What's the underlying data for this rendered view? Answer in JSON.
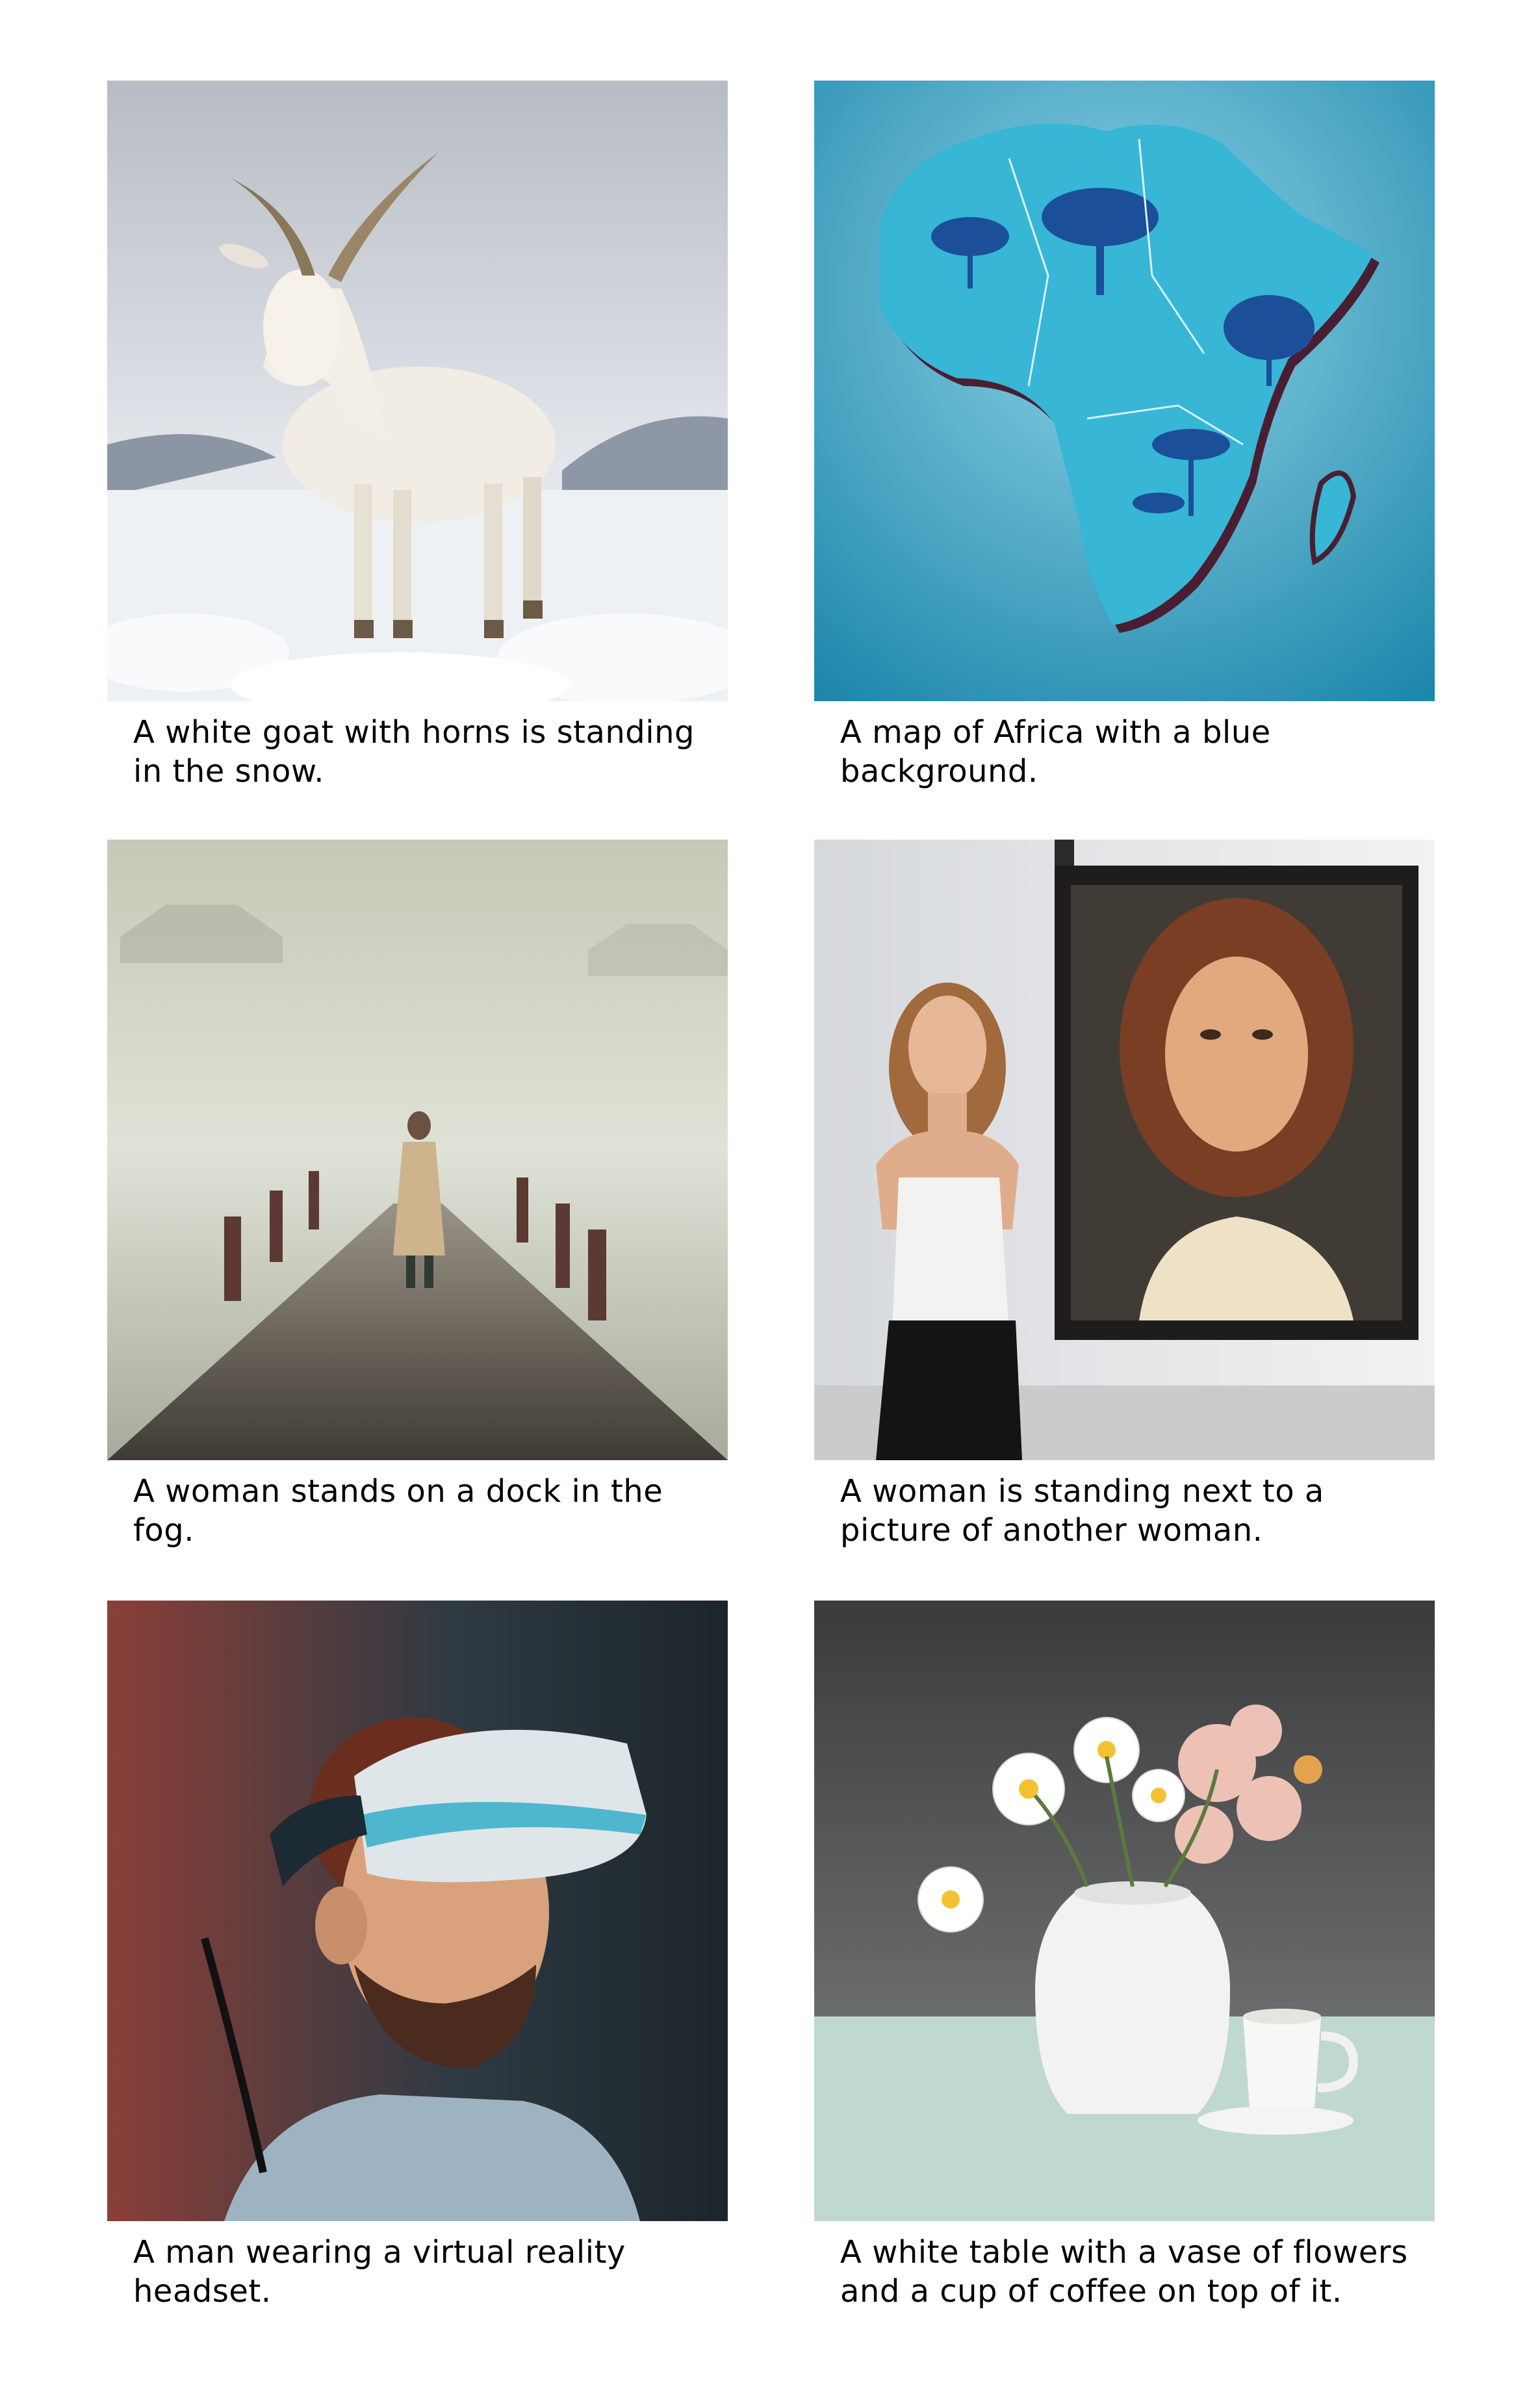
{
  "items": [
    {
      "caption": "A white goat with horns is standing in the snow."
    },
    {
      "caption": "A map of Africa with a blue background."
    },
    {
      "caption": "A woman stands on a dock in the fog."
    },
    {
      "caption": "A woman is standing next to a picture of another woman."
    },
    {
      "caption": "A man wearing a virtual reality headset."
    },
    {
      "caption": "A white table with a vase of flowers and a cup of coffee on top of it."
    }
  ]
}
